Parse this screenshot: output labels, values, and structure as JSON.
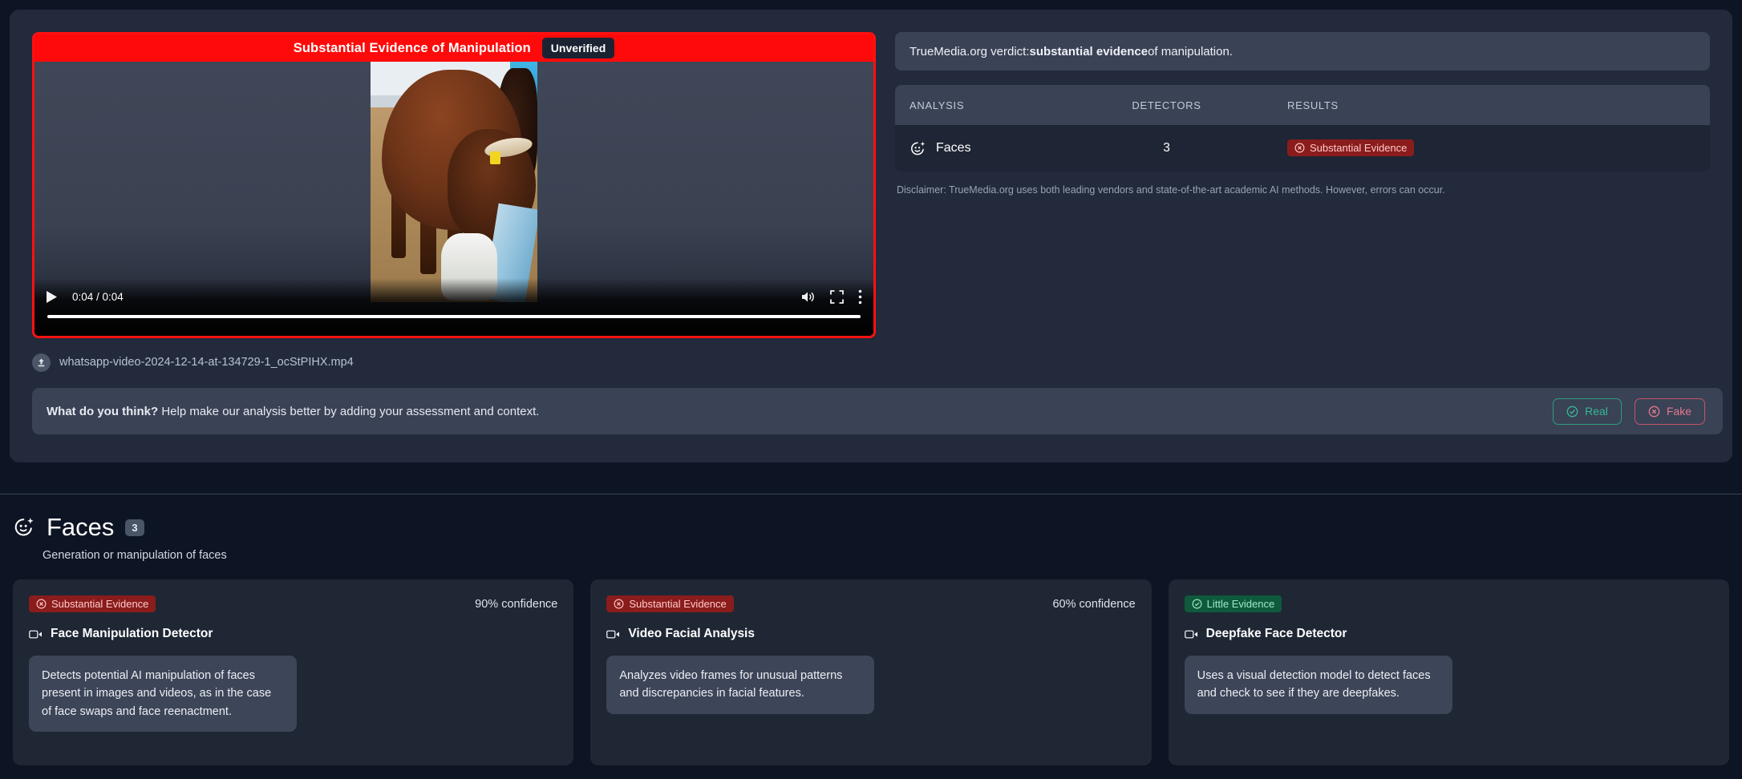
{
  "video": {
    "banner_title": "Substantial Evidence of Manipulation",
    "unverified_label": "Unverified",
    "time_display": "0:04 / 0:04",
    "filename": "whatsapp-video-2024-12-14-at-134729-1_ocStPIHX.mp4",
    "upload_icon": "upload-icon",
    "play_icon": "play-icon",
    "volume_icon": "volume-icon",
    "fullscreen_icon": "fullscreen-icon",
    "more_icon": "more-options-icon"
  },
  "feedback": {
    "prompt_bold": "What do you think?",
    "prompt_rest": " Help make our analysis better by adding your assessment and context.",
    "real_label": "Real",
    "fake_label": "Fake",
    "real_icon": "check-circle-icon",
    "fake_icon": "x-circle-icon"
  },
  "verdict": {
    "prefix": "TrueMedia.org verdict: ",
    "emphasis": "substantial evidence",
    "suffix": " of manipulation."
  },
  "table": {
    "headers": {
      "analysis": "ANALYSIS",
      "detectors": "DETECTORS",
      "results": "RESULTS"
    },
    "rows": [
      {
        "analysis": "Faces",
        "icon": "face-sparkle-icon",
        "detectors": "3",
        "result_label": "Substantial Evidence",
        "result_type": "red"
      }
    ],
    "disclaimer": "Disclaimer: TrueMedia.org uses both leading vendors and state-of-the-art academic AI methods. However, errors can occur."
  },
  "faces_section": {
    "title": "Faces",
    "count": "3",
    "subtitle": "Generation or manipulation of faces",
    "icon": "face-sparkle-icon",
    "cards": [
      {
        "badge_label": "Substantial Evidence",
        "badge_type": "red",
        "confidence": "90% confidence",
        "name": "Face Manipulation Detector",
        "icon": "video-camera-icon",
        "description": "Detects potential AI manipulation of faces present in images and videos, as in the case of face swaps and face reenactment."
      },
      {
        "badge_label": "Substantial Evidence",
        "badge_type": "red",
        "confidence": "60% confidence",
        "name": "Video Facial Analysis",
        "icon": "video-camera-icon",
        "description": "Analyzes video frames for unusual patterns and discrepancies in facial features."
      },
      {
        "badge_label": "Little Evidence",
        "badge_type": "green",
        "confidence": "",
        "name": "Deepfake Face Detector",
        "icon": "video-camera-icon",
        "description": "Uses a visual detection model to detect faces and check to see if they are deepfakes."
      }
    ]
  },
  "colors": {
    "page_bg": "#0d1524",
    "panel_bg": "#222a3c",
    "banner_red": "#ff0a0a",
    "badge_red_bg": "#8a1c1c",
    "badge_green_bg": "#0f5a3c",
    "accent_green": "#35b896",
    "accent_red": "#e2788c"
  }
}
